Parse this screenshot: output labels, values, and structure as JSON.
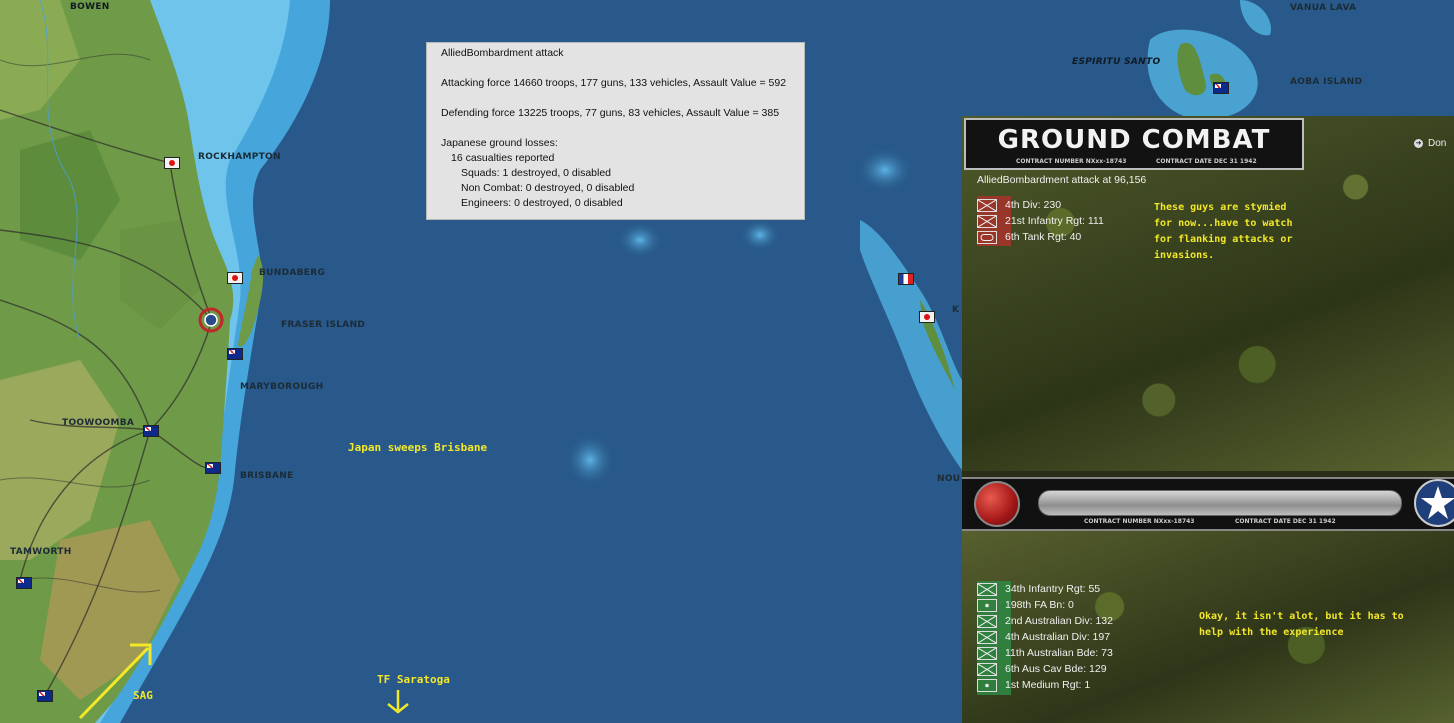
{
  "map": {
    "places": [
      {
        "name": "BOWEN"
      },
      {
        "name": "ROCKHAMPTON"
      },
      {
        "name": "BUNDABERG"
      },
      {
        "name": "FRASER ISLAND"
      },
      {
        "name": "MARYBOROUGH"
      },
      {
        "name": "TOOWOOMBA"
      },
      {
        "name": "BRISBANE"
      },
      {
        "name": "TAMWORTH"
      },
      {
        "name": "ESPIRITU SANTO"
      },
      {
        "name": "VANUA LAVA"
      },
      {
        "name": "AOBA ISLAND"
      },
      {
        "name": "K"
      },
      {
        "name": "NOU"
      }
    ],
    "annotations": {
      "japan_sweeps": "Japan sweeps Brisbane",
      "tf_saratoga": "TF Saratoga",
      "sag": "SAG"
    }
  },
  "report": {
    "title": "AlliedBombardment attack",
    "attacking": "Attacking force 14660 troops, 177 guns, 133 vehicles, Assault Value = 592",
    "defending": "Defending force 13225 troops, 77 guns, 83 vehicles, Assault Value = 385",
    "losses_header": "Japanese ground losses:",
    "casualties": "16 casualties reported",
    "squads": "Squads: 1 destroyed, 0 disabled",
    "noncombat": "Non Combat: 0 destroyed, 0 disabled",
    "engineers": "Engineers: 0 destroyed, 0 disabled"
  },
  "combat_panel": {
    "banner_title": "GROUND COMBAT",
    "contract_number": "CONTRACT NUMBER  NXxx-18743",
    "contract_date": "CONTRACT DATE DEC 31 1942",
    "attack_title": "AlliedBombardment attack at 96,156",
    "done_label": "Don",
    "japanese_units": [
      {
        "label": "4th Div: 230",
        "type": "infantry"
      },
      {
        "label": "21st Infantry Rgt: 111",
        "type": "infantry"
      },
      {
        "label": "6th Tank Rgt: 40",
        "type": "armor"
      }
    ],
    "japanese_note": "These guys are stymied\nfor now...have to watch\nfor flanking attacks or\ninvasions.",
    "allied_units": [
      {
        "label": "34th Infantry Rgt: 55",
        "type": "infantry"
      },
      {
        "label": "198th FA Bn: 0",
        "type": "artillery"
      },
      {
        "label": "2nd Australian Div: 132",
        "type": "infantry"
      },
      {
        "label": "4th Australian Div: 197",
        "type": "infantry"
      },
      {
        "label": "11th Australian Bde: 73",
        "type": "infantry"
      },
      {
        "label": "6th Aus Cav Bde: 129",
        "type": "infantry"
      },
      {
        "label": "1st Medium Rgt: 1",
        "type": "artillery"
      }
    ],
    "allied_note": "Okay, it isn't alot, but it has to\nhelp with the experience"
  },
  "colors": {
    "japanese_unit": "#a8322c",
    "allied_unit": "#2f8a44",
    "annotation": "#f2e829",
    "ocean": "#27557e"
  }
}
